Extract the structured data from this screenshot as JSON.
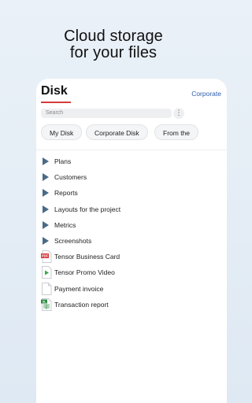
{
  "headline": {
    "line1": "Cloud storage",
    "line2": "for your files"
  },
  "app": {
    "title": "Disk",
    "corporate_link": "Corporate",
    "search_placeholder": "Search",
    "more_label": "⋮",
    "tabs": [
      "My Disk",
      "Corporate Disk",
      "From the"
    ]
  },
  "items": [
    {
      "label": "Plans",
      "icon": "folder-icon"
    },
    {
      "label": "Customers",
      "icon": "folder-icon"
    },
    {
      "label": "Reports",
      "icon": "folder-icon"
    },
    {
      "label": "Layouts for the project",
      "icon": "folder-icon"
    },
    {
      "label": "Metrics",
      "icon": "folder-icon"
    },
    {
      "label": "Screenshots",
      "icon": "folder-icon"
    },
    {
      "label": "Tensor Business Card",
      "icon": "pdf-file-icon",
      "badge": "PDF"
    },
    {
      "label": "Tensor Promo Video",
      "icon": "video-file-icon"
    },
    {
      "label": "Payment invoice",
      "icon": "document-file-icon"
    },
    {
      "label": "Transaction report",
      "icon": "spreadsheet-file-icon",
      "badge": "XL"
    }
  ],
  "colors": {
    "accent": "#d53a3a",
    "link": "#2d5dad",
    "folder": "#4a6a87"
  }
}
